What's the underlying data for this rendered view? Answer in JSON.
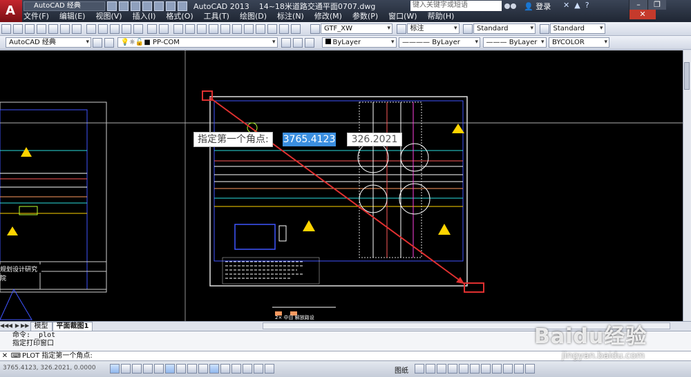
{
  "titlebar": {
    "workspace": "AutoCAD 经典",
    "app_version": "AutoCAD 2013",
    "file_name": "14~18米道路交通平面0707.dwg",
    "search_placeholder": "键入关键字或短语",
    "login": "登录",
    "logo_letter": "A"
  },
  "menu": [
    "文件(F)",
    "编辑(E)",
    "视图(V)",
    "插入(I)",
    "格式(O)",
    "工具(T)",
    "绘图(D)",
    "标注(N)",
    "修改(M)",
    "参数(P)",
    "窗口(W)",
    "帮助(H)"
  ],
  "toolbar1": {
    "text_style": "GTF_XW",
    "dim_style": "标注",
    "table_style": "Standard",
    "multileader_style": "Standard"
  },
  "toolbar2": {
    "workspace": "AutoCAD 经典",
    "layer": "PP-COM",
    "color": "ByLayer",
    "linetype": "ByLayer",
    "lineweight": "ByLayer",
    "plotstyle": "BYCOLOR"
  },
  "canvas": {
    "prompt": "指定第一个角点:",
    "coord_x": "3765.4123",
    "coord_y": "326.2021",
    "left_sheet_label": "规划设计研究院",
    "legend_note": "2× 中目  解放路设"
  },
  "tabs": {
    "model": "模型",
    "layout": "平面裁图1"
  },
  "command": {
    "history_1": "命令:  _plot",
    "history_2": "指定打印窗口",
    "prompt": "PLOT 指定第一个角点:"
  },
  "statusbar": {
    "coords": "3765.4123, 326.2021, 0.0000",
    "paper_label": "图纸"
  },
  "watermark": {
    "brand": "Baidu经验",
    "url": "jingyan.baidu.com"
  },
  "colors": {
    "title_bg": "#1f2633",
    "canvas_bg": "#000000",
    "selection_red": "#e03030",
    "coord_highlight": "#3b8fe0"
  }
}
